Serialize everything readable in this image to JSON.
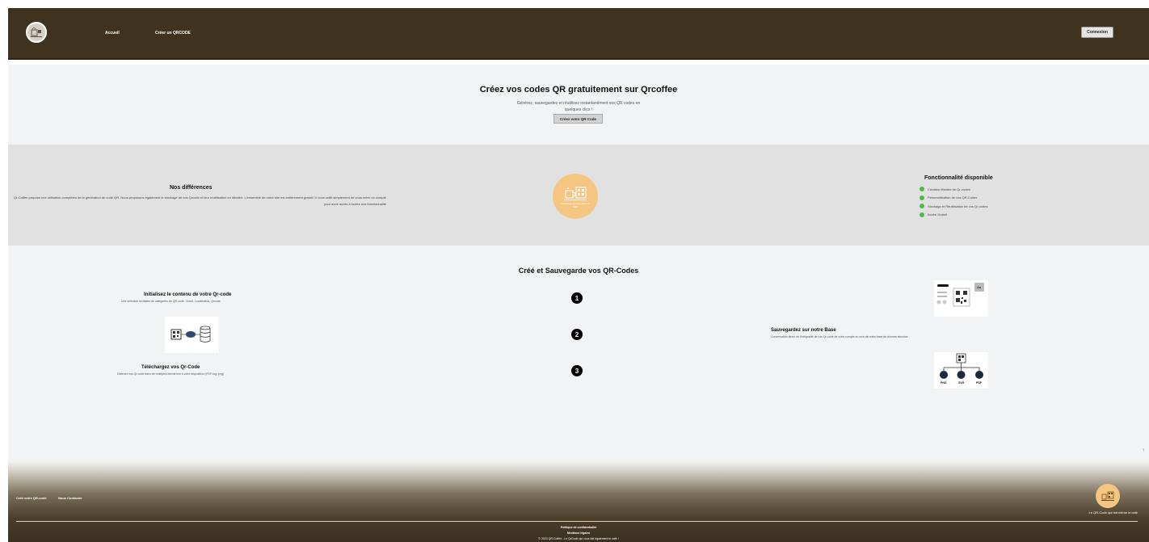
{
  "nav": {
    "home": "Accueil",
    "create": "Créer un QRCODE",
    "login": "Connexion"
  },
  "hero": {
    "title": "Créez vos codes QR gratuitement sur Qrcoffee",
    "subtitle": "Générez, sauvegardez et réutilisez instantanément vos QR codes en quelques clics !",
    "button": "Créez votre QR Code"
  },
  "differences": {
    "title": "Nos différences",
    "text": "Qr-Coffee propose une utilisation complètes de la génération de code QR. Nous proposons également le stockage de vos Qrcode et leur réutilisation en illimitée. L'ensemble de notre site est entièrement gratuit ! Il vous suffit simplement de vous créer un compte pour avoir accès à toutes nos fonctionnalité",
    "badge_text": "Le qrcode qui fait même le café"
  },
  "features": {
    "title": "Fonctionnalité disponible",
    "items": [
      "Création illimitée de Qr-codes",
      "Personnification de vos QR-Codes",
      "Stockage et Réutilisation de vos Qr-codes",
      "Accès Gratuit"
    ],
    "dot_color": "#4cbb47"
  },
  "steps": {
    "title": "Créé et Sauvegarde vos QR-Codes",
    "numbers": [
      "1",
      "2",
      "3"
    ],
    "step1": {
      "title": "Initialisez le contenu de votre Qr-code",
      "desc": "Une selection multiples de catégories de QR-code. Vcard, Localisation, Qrcode"
    },
    "step2": {
      "title": "Sauvegardez sur notre Base",
      "desc": "Conservation direct de l'intégralité de vos Qr-code de votre compte au sein de notre base de donnée sécurisé"
    },
    "step3": {
      "title": "Téléchargez vos Qr-Code",
      "desc": "Obtenez vos Qr-code dans de multiples format mis à votre disposition (PDF,svg, png)"
    },
    "formats": [
      "PNG",
      "SVG",
      "PDF"
    ],
    "style_label": "Aa"
  },
  "footer": {
    "link1": "Créé votre QR-code",
    "link2": "Nous Contacter",
    "slogan": "Le QR-Code qui fait même le café",
    "privacy": "Politique de confidentialité",
    "legal": "Mentions légales",
    "copyright": "© 2023 QR-Coffee - Le QrCode qui vous fait également le café !"
  },
  "colors": {
    "nav_bg": "#3f3320",
    "accent": "#f5c682"
  }
}
